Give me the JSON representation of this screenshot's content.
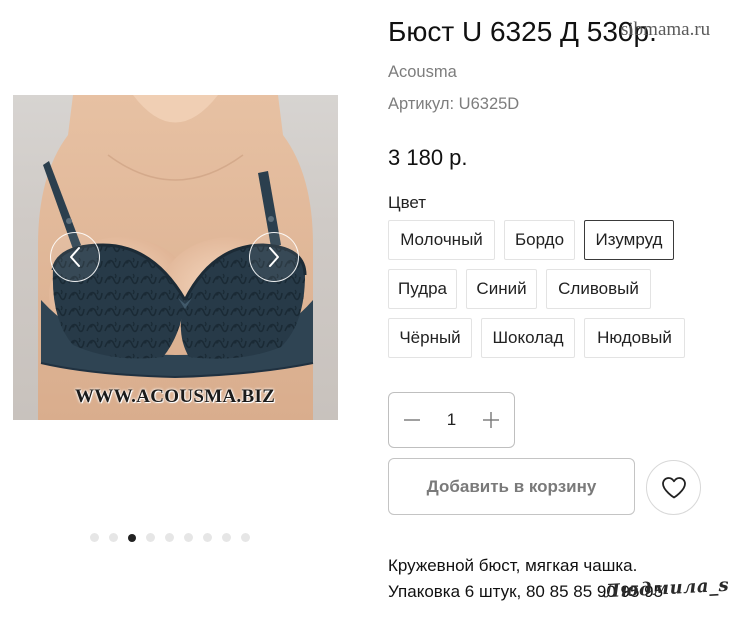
{
  "product": {
    "title": "Бюст U 6325 Д 530р.",
    "brand": "Acousma",
    "sku": "Артикул: U6325D",
    "price": "3 180 р."
  },
  "overlay": {
    "site_watermark": "sibmama.ru",
    "image_watermark": "WWW.ACOUSMA.BIZ",
    "signature": "Людмила_s"
  },
  "gallery": {
    "slide_count": 9,
    "active_slide": 3
  },
  "color_selector": {
    "label": "Цвет",
    "options": [
      {
        "label": "Молочный"
      },
      {
        "label": "Бордо"
      },
      {
        "label": "Изумруд"
      },
      {
        "label": "Пудра"
      },
      {
        "label": "Синий"
      },
      {
        "label": "Сливовый"
      },
      {
        "label": "Чёрный"
      },
      {
        "label": "Шоколад"
      },
      {
        "label": "Нюдовый"
      }
    ],
    "selected": "Изумруд"
  },
  "quantity": {
    "value": "1"
  },
  "actions": {
    "add_to_cart": "Добавить в корзину"
  },
  "description": {
    "line1": "Кружевной бюст, мягкая чашка.",
    "line2": "Упаковка 6 штук, 80 85 85 90 95 95"
  },
  "colors": {
    "fabric": "#2b3f4e",
    "skin": "#e9c4a6",
    "border": "#e3e3e3",
    "selected_border": "#3a3a3a"
  }
}
